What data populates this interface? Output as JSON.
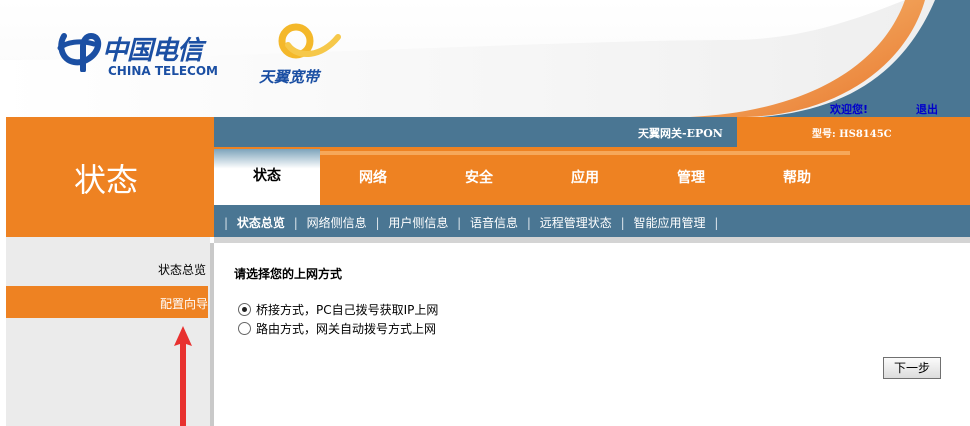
{
  "header": {
    "brand_cn": "中国电信",
    "brand_en": "CHINA TELECOM",
    "product_brand": "天翼宽带",
    "welcome": "欢迎您!",
    "logout": "退出"
  },
  "left_title": "状态",
  "topbar": {
    "device_name": "天翼网关-EPON",
    "model": "型号: HS8145C"
  },
  "nav": {
    "tabs": [
      {
        "label": "状态",
        "active": true
      },
      {
        "label": "网络",
        "active": false
      },
      {
        "label": "安全",
        "active": false
      },
      {
        "label": "应用",
        "active": false
      },
      {
        "label": "管理",
        "active": false
      },
      {
        "label": "帮助",
        "active": false
      }
    ]
  },
  "subnav": {
    "items": [
      "状态总览",
      "网络侧信息",
      "用户侧信息",
      "语音信息",
      "远程管理状态",
      "智能应用管理"
    ],
    "active_index": 0
  },
  "leftmenu": {
    "items": [
      "状态总览",
      "配置向导"
    ],
    "active_index": 1
  },
  "content": {
    "title": "请选择您的上网方式",
    "options": [
      {
        "label": "桥接方式，PC自己拨号获取IP上网",
        "checked": true
      },
      {
        "label": "路由方式，网关自动拨号方式上网",
        "checked": false
      }
    ],
    "next_button": "下一步"
  },
  "colors": {
    "orange": "#ee8222",
    "steel_blue": "#4a7693",
    "brand_blue": "#1b4fa3",
    "arrow_red": "#e8312f"
  }
}
